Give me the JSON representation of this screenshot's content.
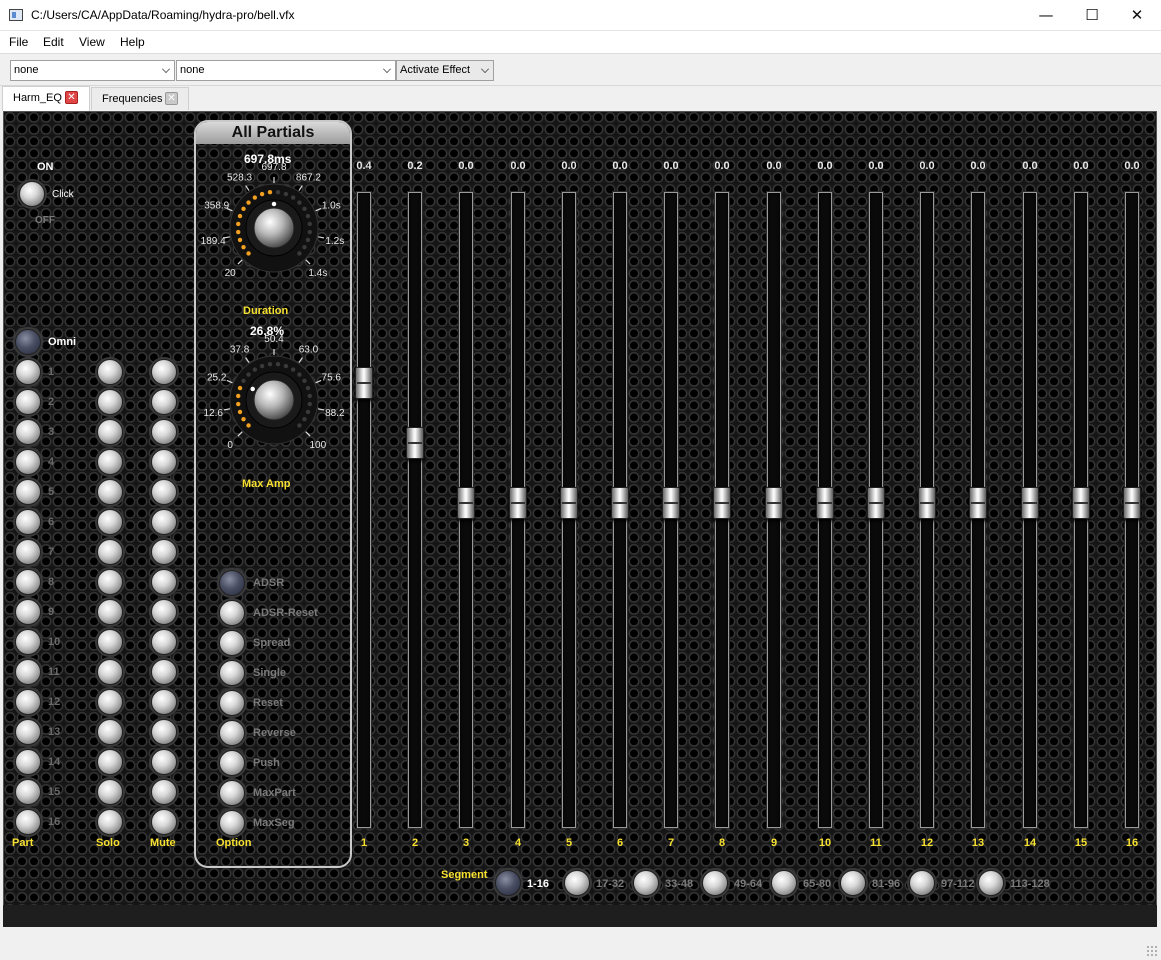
{
  "window": {
    "title": "C:/Users/CA/AppData/Roaming/hydra-pro/bell.vfx",
    "minimize": "—",
    "maximize": "☐",
    "close": "✕"
  },
  "menu": [
    "File",
    "Edit",
    "View",
    "Help"
  ],
  "toolbar": {
    "combo1": "none",
    "combo2": "none",
    "activate": "Activate Effect"
  },
  "tabs": [
    {
      "label": "Harm_EQ",
      "active": true
    },
    {
      "label": "Frequencies",
      "active": false
    }
  ],
  "onoff": {
    "on": "ON",
    "click": "Click",
    "off": "OFF"
  },
  "omni": "Omni",
  "parts": [
    "1",
    "2",
    "3",
    "4",
    "5",
    "6",
    "7",
    "8",
    "9",
    "10",
    "11",
    "12",
    "13",
    "14",
    "15",
    "16"
  ],
  "columns": {
    "part": "Part",
    "solo": "Solo",
    "mute": "Mute",
    "option": "Option"
  },
  "group": {
    "title": "All Partials",
    "duration": {
      "label": "Duration",
      "value": "697.8ms",
      "level": 0.5,
      "ticks": [
        "20",
        "189.4",
        "358.9",
        "528.3",
        "697.8",
        "867.2",
        "1.0s",
        "1.2s",
        "1.4s"
      ]
    },
    "maxamp": {
      "label": "Max Amp",
      "value": "26.8%",
      "level": 0.268,
      "ticks": [
        "0",
        "12.6",
        "25.2",
        "37.8",
        "50.4",
        "63.0",
        "75.6",
        "88.2",
        "100"
      ]
    },
    "options": [
      {
        "label": "ADSR",
        "on": true
      },
      {
        "label": "ADSR-Reset",
        "on": false
      },
      {
        "label": "Spread",
        "on": false
      },
      {
        "label": "Single",
        "on": false
      },
      {
        "label": "Reset",
        "on": false
      },
      {
        "label": "Reverse",
        "on": false
      },
      {
        "label": "Push",
        "on": false
      },
      {
        "label": "MaxPart",
        "on": false
      },
      {
        "label": "MaxSeg",
        "on": false
      }
    ]
  },
  "sliders": [
    {
      "label": "1",
      "value": "0.4",
      "level": 0.4
    },
    {
      "label": "2",
      "value": "0.2",
      "level": 0.2
    },
    {
      "label": "3",
      "value": "0.0",
      "level": 0.0
    },
    {
      "label": "4",
      "value": "0.0",
      "level": 0.0
    },
    {
      "label": "5",
      "value": "0.0",
      "level": 0.0
    },
    {
      "label": "6",
      "value": "0.0",
      "level": 0.0
    },
    {
      "label": "7",
      "value": "0.0",
      "level": 0.0
    },
    {
      "label": "8",
      "value": "0.0",
      "level": 0.0
    },
    {
      "label": "9",
      "value": "0.0",
      "level": 0.0
    },
    {
      "label": "10",
      "value": "0.0",
      "level": 0.0
    },
    {
      "label": "11",
      "value": "0.0",
      "level": 0.0
    },
    {
      "label": "12",
      "value": "0.0",
      "level": 0.0
    },
    {
      "label": "13",
      "value": "0.0",
      "level": 0.0
    },
    {
      "label": "14",
      "value": "0.0",
      "level": 0.0
    },
    {
      "label": "15",
      "value": "0.0",
      "level": 0.0
    },
    {
      "label": "16",
      "value": "0.0",
      "level": 0.0
    }
  ],
  "segment": {
    "label": "Segment",
    "options": [
      {
        "label": "1-16",
        "on": true
      },
      {
        "label": "17-32",
        "on": false
      },
      {
        "label": "33-48",
        "on": false
      },
      {
        "label": "49-64",
        "on": false
      },
      {
        "label": "65-80",
        "on": false
      },
      {
        "label": "81-96",
        "on": false
      },
      {
        "label": "97-112",
        "on": false
      },
      {
        "label": "113-128",
        "on": false
      }
    ]
  },
  "colors": {
    "accent": "#f6e030",
    "knob_led": "#f2a020"
  }
}
